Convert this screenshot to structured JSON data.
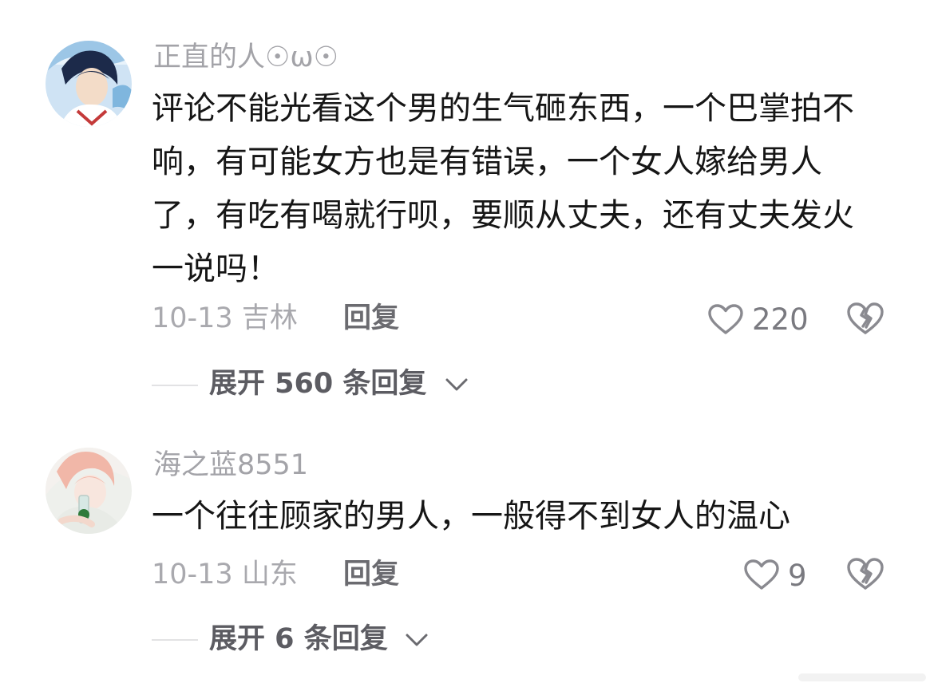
{
  "comments": [
    {
      "username": "正直的人☉ω☉",
      "text": "评论不能光看这个男的生气砸东西，一个巴掌拍不响，有可能女方也是有错误，一个女人嫁给男人了，有吃有喝就行呗，要顺从丈夫，还有丈夫发火一说吗！",
      "date_location": "10-13 吉林",
      "reply_label": "回复",
      "like_count": "220",
      "expand_label": "展开 560 条回复"
    },
    {
      "username": "海之蓝8551",
      "text": "一个往往顾家的男人，一般得不到女人的温心",
      "date_location": "10-13 山东",
      "reply_label": "回复",
      "like_count": "9",
      "expand_label": "展开 6 条回复"
    }
  ],
  "icons": {
    "like": "heart-outline-icon",
    "dislike": "broken-heart-icon",
    "expand": "chevron-down-icon"
  },
  "colors": {
    "username": "#a3a3a8",
    "content": "#161616",
    "meta": "#a9a9ae",
    "action": "#6b6b70"
  }
}
